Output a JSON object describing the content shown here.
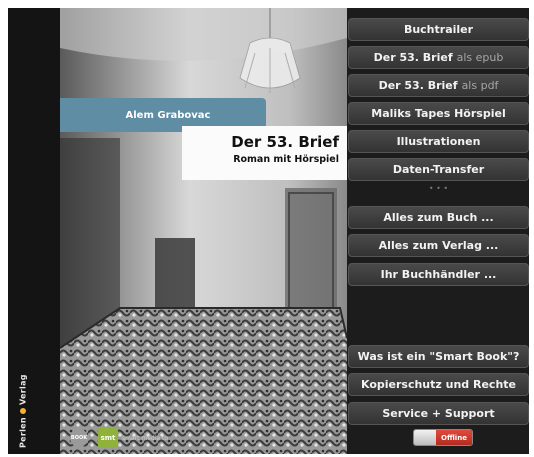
{
  "spine": {
    "author_short": "Perlen",
    "publisher": "Verlag"
  },
  "cover": {
    "author": "Alem Grabovac",
    "title": "Der 53. Brief",
    "subtitle": "Roman mit Hörspiel",
    "logo_circle": "BOOK",
    "logo_smt": "smt",
    "logo_smt_text": "smart media to"
  },
  "menu": {
    "items": [
      {
        "label": "Buchtrailer",
        "suffix": ""
      },
      {
        "label": "Der 53. Brief",
        "suffix": "als epub"
      },
      {
        "label": "Der 53. Brief",
        "suffix": "als pdf"
      },
      {
        "label": "Maliks Tapes Hörspiel",
        "suffix": ""
      },
      {
        "label": "Illustrationen",
        "suffix": ""
      },
      {
        "label": "Daten-Transfer",
        "suffix": ""
      },
      {
        "label": "Alles zum Buch ...",
        "suffix": ""
      },
      {
        "label": "Alles zum Verlag ...",
        "suffix": ""
      },
      {
        "label": "Ihr Buchhändler ...",
        "suffix": ""
      },
      {
        "label": "Was ist ein \"Smart Book\"?",
        "suffix": ""
      },
      {
        "label": "Kopierschutz und Rechte",
        "suffix": ""
      },
      {
        "label": "Service + Support",
        "suffix": ""
      }
    ],
    "separator": "• • •"
  },
  "toggle": {
    "label": "Offline",
    "state": "off"
  },
  "colors": {
    "author_band": "#5f8da4",
    "toggle_red": "#c8342a",
    "publisher_dot": "#f2b233"
  }
}
